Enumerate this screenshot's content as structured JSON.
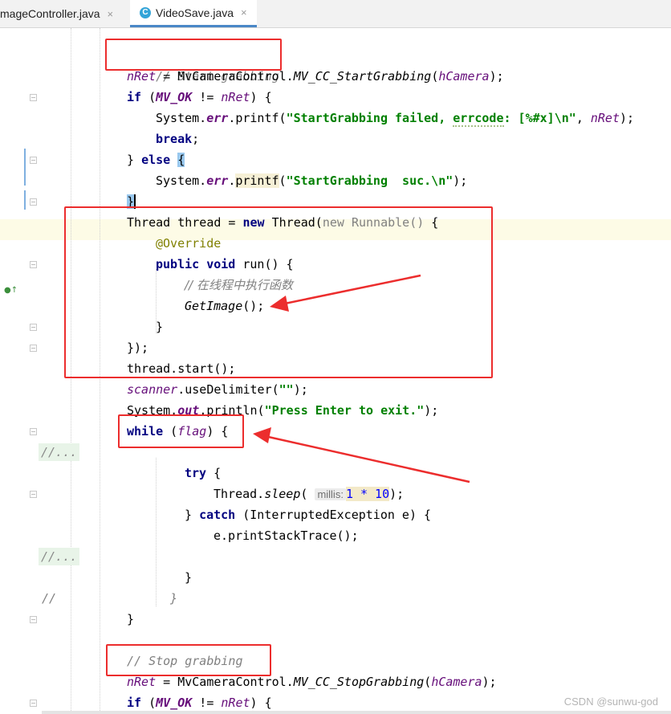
{
  "tabs": [
    {
      "label": "mageController.java",
      "close": "×",
      "active": false
    },
    {
      "label": "VideoSave.java",
      "close": "×",
      "active": true,
      "icon": "C"
    }
  ],
  "code": {
    "l1_comment": "// Start grabbing",
    "l2_var": "nRet",
    "l2_eq": " = MvCameraControl.",
    "l2_fn": "MV_CC_StartGrabbing",
    "l2_open": "(",
    "l2_arg": "hCamera",
    "l2_close": ");",
    "l3_if": "if",
    "l3_open": " (",
    "l3_const": "MV_OK",
    "l3_ne": " != ",
    "l3_var": "nRet",
    "l3_close": ") {",
    "l4_sys": "System.",
    "l4_err": "err",
    "l4_call": ".printf(",
    "l4_str1": "\"StartGrabbing failed, ",
    "l4_str2": "errcode",
    "l4_str3": ": [%#x]\\n\"",
    "l4_sep": ", ",
    "l4_var": "nRet",
    "l4_end": ");",
    "l5_break": "break",
    "l5_semi": ";",
    "l6_close": "} ",
    "l6_else": "else",
    "l6_sp": " ",
    "l6_brace": "{",
    "l7_sys": "System.",
    "l7_err": "err",
    "l7_dot": ".",
    "l7_printf": "printf",
    "l7_open": "(",
    "l7_str": "\"StartGrabbing  suc.\\n\"",
    "l7_end": ");",
    "l8_brace": "}",
    "l9_a": "Thread thread = ",
    "l9_new": "new",
    "l9_b": " Thread(",
    "l9_c": "new Runnable()",
    "l9_d": " {",
    "l10_anno": "@Override",
    "l11_public": "public",
    "l11_sp": " ",
    "l11_void": "void",
    "l11_run": " run() {",
    "l12_comment": "// 在线程中执行函数",
    "l13_fn": "GetImage",
    "l13_end": "();",
    "l14_brace": "}",
    "l15_end": "});",
    "l16": "thread.start();",
    "l17_var": "scanner",
    "l17_rest": ".useDelimiter(",
    "l17_str": "\"\"",
    "l17_end": ");",
    "l18_sys": "System.",
    "l18_out": "out",
    "l18_call": ".println(",
    "l18_str": "\"Press Enter to exit.\"",
    "l18_end": ");",
    "l19_while": "while",
    "l19_open": " (",
    "l19_flag": "flag",
    "l19_close": ") {",
    "fold1": "//...",
    "l21_try": "try",
    "l21_brace": " {",
    "l22_a": "Thread.",
    "l22_sleep": "sleep",
    "l22_open": "( ",
    "l22_hint": "millis:",
    "l22_num": "1 * 10",
    "l22_end": ");",
    "l23_a": "} ",
    "l23_catch": "catch",
    "l23_b": " (InterruptedException e) {",
    "l24": "e.printStackTrace();",
    "fold2": "//...",
    "l26_brace": "}",
    "l27_cmt": "//",
    "l27_brace": "}",
    "l28_brace": "}",
    "l29_comment": "// Stop grabbing",
    "l30_var": "nRet",
    "l30_eq": " = MvCameraControl.",
    "l30_fn": "MV_CC_StopGrabbing",
    "l30_open": "(",
    "l30_arg": "hCamera",
    "l30_close": ");",
    "l31_if": "if",
    "l31_open": " (",
    "l31_const": "MV_OK",
    "l31_ne": " != ",
    "l31_var": "nRet",
    "l31_close": ") {"
  },
  "watermark": "CSDN @sunwu-god",
  "colors": {
    "annotation_red": "#ec2d2d",
    "tab_accent": "#4a88c7"
  }
}
